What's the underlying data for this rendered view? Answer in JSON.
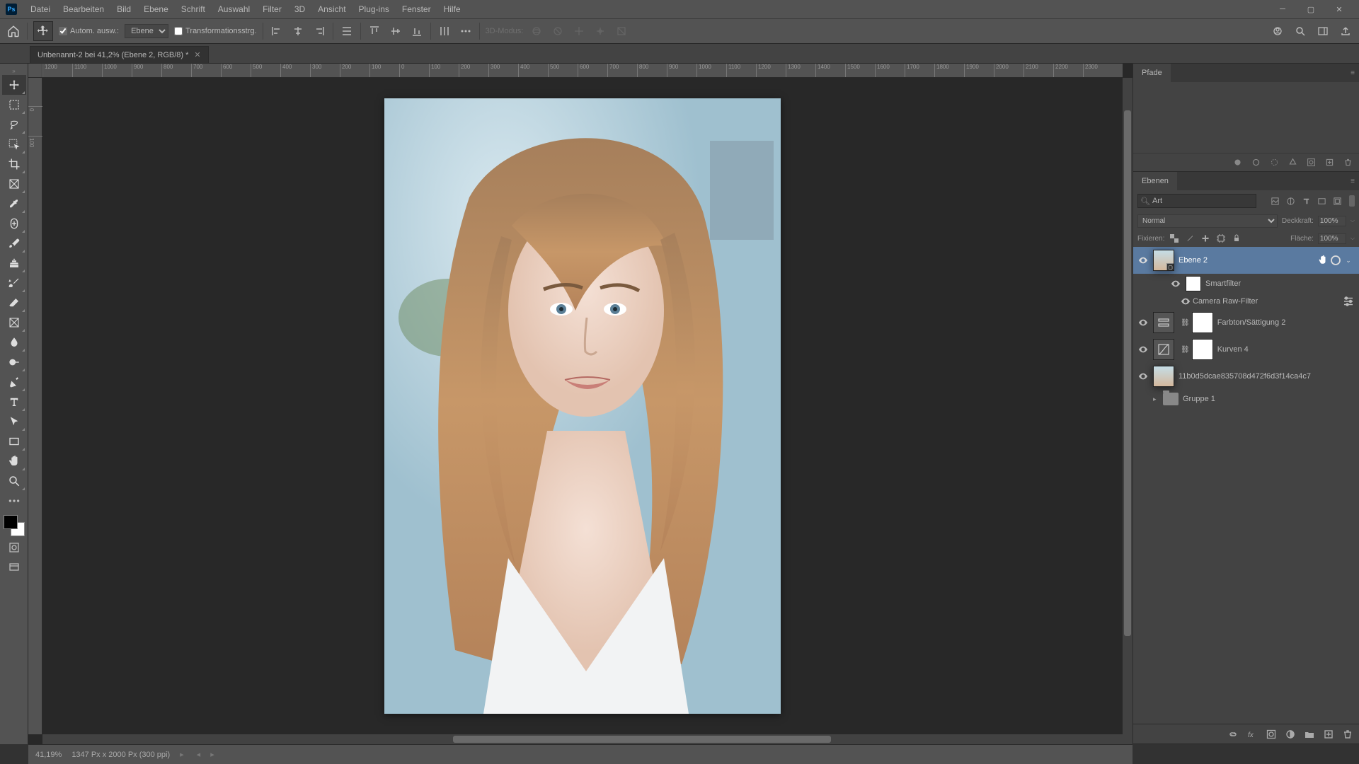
{
  "menu": {
    "items": [
      "Datei",
      "Bearbeiten",
      "Bild",
      "Ebene",
      "Schrift",
      "Auswahl",
      "Filter",
      "3D",
      "Ansicht",
      "Plug-ins",
      "Fenster",
      "Hilfe"
    ]
  },
  "optionsbar": {
    "auto_select_label": "Autom. ausw.:",
    "auto_select_dropdown": "Ebene",
    "transform_label": "Transformationsstrg.",
    "mode3d_label": "3D-Modus:"
  },
  "document": {
    "tab_title": "Unbenannt-2 bei 41,2% (Ebene 2, RGB/8) *"
  },
  "ruler_h": [
    "1200",
    "1100",
    "1000",
    "900",
    "800",
    "700",
    "600",
    "500",
    "400",
    "300",
    "200",
    "100",
    "0",
    "100",
    "200",
    "300",
    "400",
    "500",
    "600",
    "700",
    "800",
    "900",
    "1000",
    "1100",
    "1200",
    "1300",
    "1400",
    "1500",
    "1600",
    "1700",
    "1800",
    "1900",
    "2000",
    "2100",
    "2200",
    "2300"
  ],
  "ruler_v": [
    "0",
    "100"
  ],
  "panels": {
    "paths": {
      "tab": "Pfade"
    },
    "layers": {
      "tab": "Ebenen",
      "search_value": "Art",
      "blend_mode": "Normal",
      "opacity_label": "Deckkraft:",
      "opacity_value": "100%",
      "lock_label": "Fixieren:",
      "fill_label": "Fläche:",
      "fill_value": "100%",
      "items": [
        {
          "name": "Ebene 2"
        },
        {
          "name": "Smartfilter"
        },
        {
          "name": "Camera Raw-Filter"
        },
        {
          "name": "Farbton/Sättigung 2"
        },
        {
          "name": "Kurven 4"
        },
        {
          "name": "11b0d5dcae835708d472f6d3f14ca4c7"
        },
        {
          "name": "Gruppe 1"
        }
      ]
    }
  },
  "statusbar": {
    "zoom": "41,19%",
    "doc_info": "1347 Px x 2000 Px (300 ppi)"
  }
}
